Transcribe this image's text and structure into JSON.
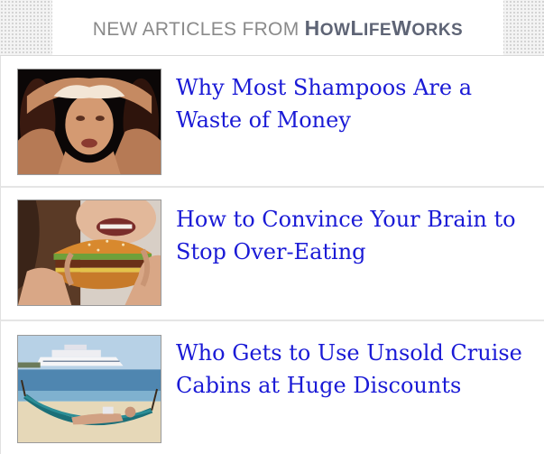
{
  "header": {
    "prefix": "NEW ARTICLES FROM",
    "brand_h": "H",
    "brand_ow": "OW",
    "brand_l": "L",
    "brand_ife": "IFE",
    "brand_w": "W",
    "brand_orks": "ORKS"
  },
  "articles": [
    {
      "title": "Why Most Shampoos Are a Waste of Money",
      "thumbnail": "woman-washing-hair-photo"
    },
    {
      "title": "How to Convince Your Brain to Stop Over-Eating",
      "thumbnail": "woman-eating-burger-photo"
    },
    {
      "title": "Who Gets to Use Unsold Cruise Cabins at Huge Discounts",
      "thumbnail": "cruise-ship-hammock-photo"
    }
  ],
  "colors": {
    "link": "#1a1ad6",
    "header_text": "#8a8a8a",
    "brand_text": "#5e6475"
  }
}
